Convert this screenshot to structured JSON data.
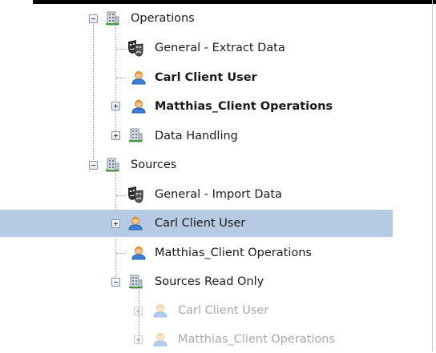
{
  "tree": {
    "nodes": [
      {
        "label": "Operations",
        "icon": "building-icon",
        "toggle": "minus",
        "bold": false,
        "dim": false
      },
      {
        "label": "General - Extract Data",
        "icon": "theater-mask-icon",
        "toggle": "none",
        "bold": false,
        "dim": false
      },
      {
        "label": "Carl Client User",
        "icon": "user-icon",
        "toggle": "none",
        "bold": true,
        "dim": false
      },
      {
        "label": "Matthias_Client Operations",
        "icon": "user-icon",
        "toggle": "plus",
        "bold": true,
        "dim": false
      },
      {
        "label": "Data Handling",
        "icon": "building-icon",
        "toggle": "plus",
        "bold": false,
        "dim": false
      },
      {
        "label": "Sources",
        "icon": "building-icon",
        "toggle": "minus",
        "bold": false,
        "dim": false
      },
      {
        "label": "General - Import Data",
        "icon": "theater-mask-icon",
        "toggle": "none",
        "bold": false,
        "dim": false
      },
      {
        "label": "Carl Client User",
        "icon": "user-icon",
        "toggle": "plus",
        "bold": false,
        "dim": false,
        "selected": true
      },
      {
        "label": "Matthias_Client Operations",
        "icon": "user-icon",
        "toggle": "none",
        "bold": false,
        "dim": false
      },
      {
        "label": "Sources Read Only",
        "icon": "building-icon",
        "toggle": "minus",
        "bold": false,
        "dim": false
      },
      {
        "label": "Carl Client User",
        "icon": "user-icon",
        "toggle": "plus",
        "bold": false,
        "dim": true
      },
      {
        "label": "Matthias_Client Operations",
        "icon": "user-icon",
        "toggle": "plus",
        "bold": false,
        "dim": true
      }
    ]
  },
  "colors": {
    "selection": "#b6cbe3",
    "dimmed_text": "#a8a8a8"
  }
}
